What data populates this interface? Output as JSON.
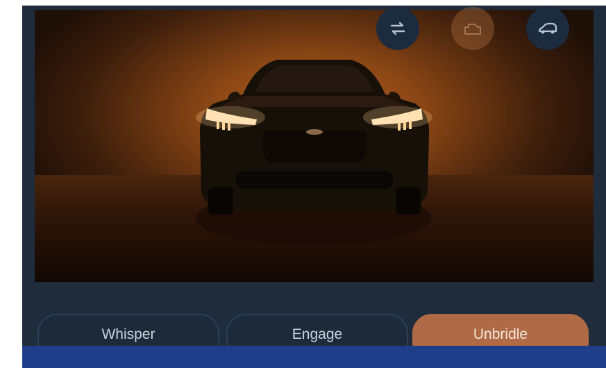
{
  "colors": {
    "background": "#1f2c3b",
    "accent": "#b06a45",
    "bottom_bar": "#1f3e8a"
  },
  "top_buttons": [
    {
      "icon": "reset-icon",
      "state": "active"
    },
    {
      "icon": "engine-icon",
      "state": "disabled"
    },
    {
      "icon": "car-icon",
      "state": "active"
    }
  ],
  "modes": {
    "items": [
      {
        "label": "Whisper",
        "selected": false
      },
      {
        "label": "Engage",
        "selected": false
      },
      {
        "label": "Unbridle",
        "selected": true
      }
    ]
  }
}
